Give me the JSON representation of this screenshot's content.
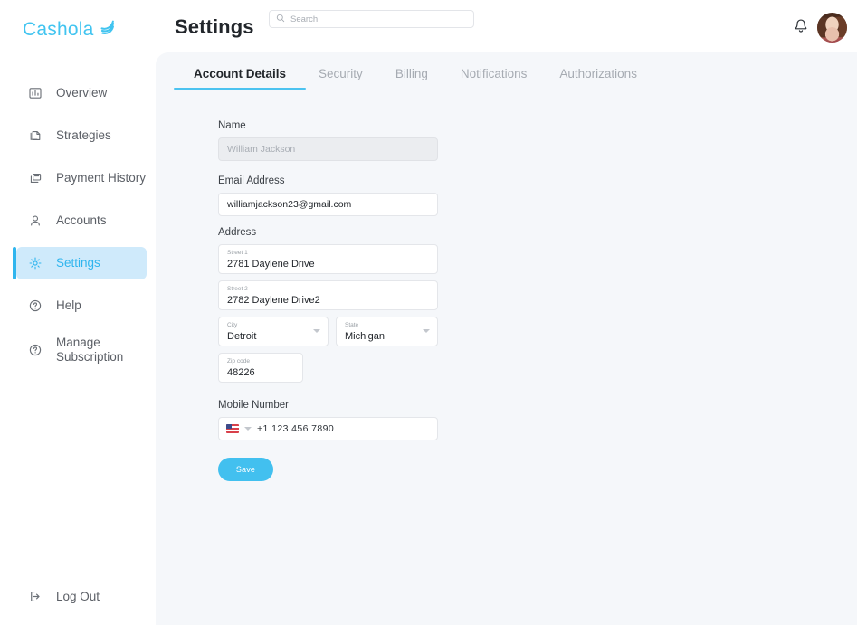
{
  "brand": {
    "name": "Cashola",
    "color": "#41c4f0",
    "logo_icon": "swirl-leaf-icon"
  },
  "header": {
    "title": "Settings",
    "search": {
      "placeholder": "Search",
      "value": "",
      "icon": "search-icon"
    },
    "notifications_icon": "bell-icon",
    "avatar": "user-avatar"
  },
  "sidebar": {
    "items": [
      {
        "label": "Overview",
        "icon": "bar-chart-icon",
        "active": false
      },
      {
        "label": "Strategies",
        "icon": "layers-document-icon",
        "active": false
      },
      {
        "label": "Payment History",
        "icon": "payment-card-icon",
        "active": false
      },
      {
        "label": "Accounts",
        "icon": "person-icon",
        "active": false
      },
      {
        "label": "Settings",
        "icon": "gear-icon",
        "active": true
      },
      {
        "label": "Help",
        "icon": "question-circle-icon",
        "active": false
      },
      {
        "label": "Manage\nSubscription",
        "icon": "question-circle-icon",
        "active": false
      }
    ],
    "logout": {
      "label": "Log Out",
      "icon": "logout-icon"
    },
    "active_bg": "#cfeafb",
    "active_color": "#2fb5ee"
  },
  "main": {
    "tabs": [
      {
        "label": "Account Details",
        "active": true
      },
      {
        "label": "Security",
        "active": false
      },
      {
        "label": "Billing",
        "active": false
      },
      {
        "label": "Notifications",
        "active": false
      },
      {
        "label": "Authorizations",
        "active": false
      }
    ],
    "form": {
      "name": {
        "label": "Name",
        "placeholder": "William Jackson",
        "value": "",
        "disabled": true
      },
      "email": {
        "label": "Email Address",
        "value": "williamjackson23@gmail.com"
      },
      "address": {
        "label": "Address",
        "street1": {
          "label": "Street 1",
          "value": "2781 Daylene Drive"
        },
        "street2": {
          "label": "Street 2",
          "value": "2782 Daylene Drive2"
        },
        "city": {
          "label": "City",
          "value": "Detroit"
        },
        "state": {
          "label": "State",
          "value": "Michigan"
        },
        "zip": {
          "label": "Zip code",
          "value": "48226"
        }
      },
      "mobile": {
        "label": "Mobile Number",
        "country_flag": "us-flag-icon",
        "value": "+1 123 456 7890"
      },
      "save_label": "Save",
      "save_color": "#42c0ef"
    }
  }
}
